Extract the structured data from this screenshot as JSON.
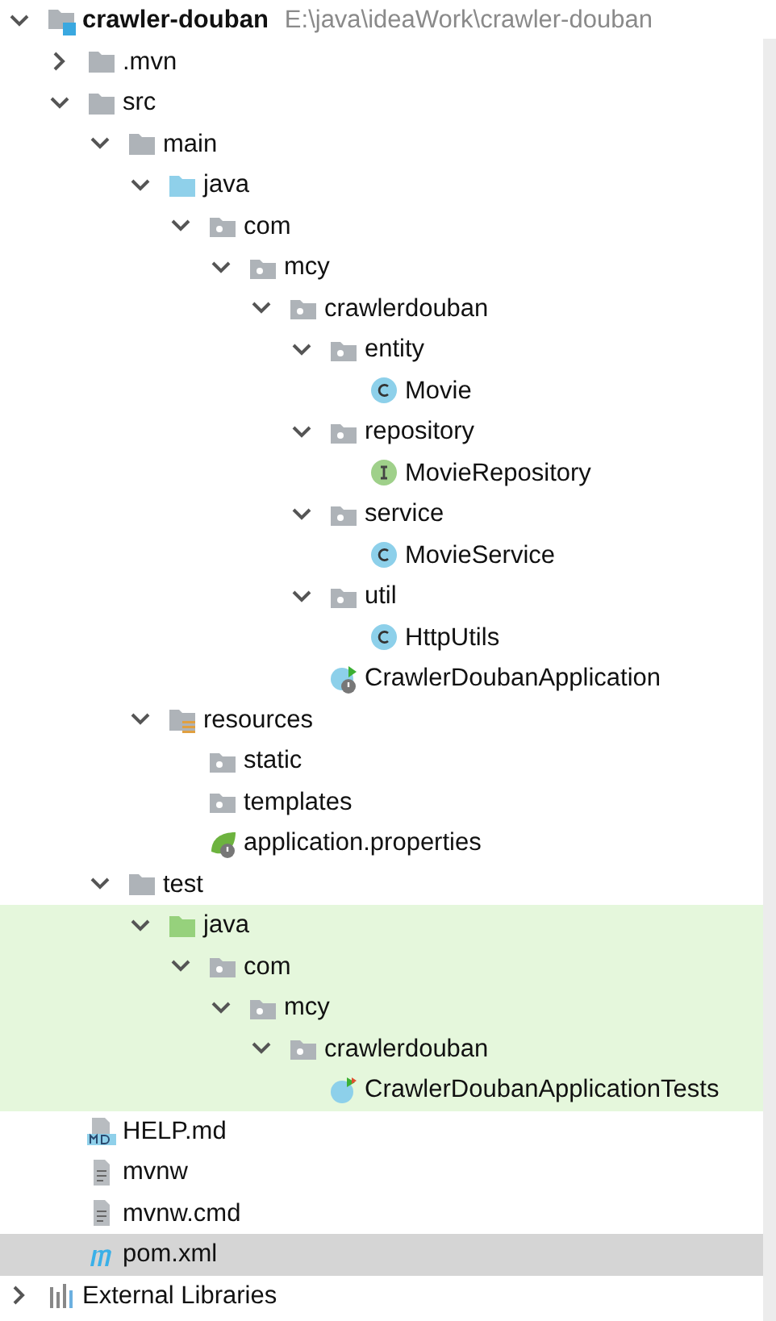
{
  "project_tree": {
    "root": {
      "name": "crawler-douban",
      "path": "E:\\java\\ideaWork\\crawler-douban",
      "kind": "module",
      "expanded": true,
      "selected": false,
      "children": [
        {
          "name": ".mvn",
          "kind": "folder",
          "expanded": false,
          "selected": false
        },
        {
          "name": "src",
          "kind": "folder",
          "expanded": true,
          "selected": false,
          "children": [
            {
              "name": "main",
              "kind": "folder",
              "expanded": true,
              "selected": false,
              "children": [
                {
                  "name": "java",
                  "kind": "source_folder",
                  "expanded": true,
                  "selected": false,
                  "children": [
                    {
                      "name": "com",
                      "kind": "package",
                      "expanded": true,
                      "selected": false,
                      "children": [
                        {
                          "name": "mcy",
                          "kind": "package",
                          "expanded": true,
                          "selected": false,
                          "children": [
                            {
                              "name": "crawlerdouban",
                              "kind": "package",
                              "expanded": true,
                              "selected": false,
                              "children": [
                                {
                                  "name": "entity",
                                  "kind": "package",
                                  "expanded": true,
                                  "selected": false,
                                  "children": [
                                    {
                                      "name": "Movie",
                                      "kind": "class",
                                      "selected": false
                                    }
                                  ]
                                },
                                {
                                  "name": "repository",
                                  "kind": "package",
                                  "expanded": true,
                                  "selected": false,
                                  "children": [
                                    {
                                      "name": "MovieRepository",
                                      "kind": "interface",
                                      "selected": false
                                    }
                                  ]
                                },
                                {
                                  "name": "service",
                                  "kind": "package",
                                  "expanded": true,
                                  "selected": false,
                                  "children": [
                                    {
                                      "name": "MovieService",
                                      "kind": "class",
                                      "selected": false
                                    }
                                  ]
                                },
                                {
                                  "name": "util",
                                  "kind": "package",
                                  "expanded": true,
                                  "selected": false,
                                  "children": [
                                    {
                                      "name": "HttpUtils",
                                      "kind": "class",
                                      "selected": false
                                    }
                                  ]
                                },
                                {
                                  "name": "CrawlerDoubanApplication",
                                  "kind": "spring_app",
                                  "selected": false
                                }
                              ]
                            }
                          ]
                        }
                      ]
                    }
                  ]
                },
                {
                  "name": "resources",
                  "kind": "resources_folder",
                  "expanded": true,
                  "selected": false,
                  "children": [
                    {
                      "name": "static",
                      "kind": "package",
                      "selected": false
                    },
                    {
                      "name": "templates",
                      "kind": "package",
                      "selected": false
                    },
                    {
                      "name": "application.properties",
                      "kind": "spring_props",
                      "selected": false
                    }
                  ]
                }
              ]
            },
            {
              "name": "test",
              "kind": "folder",
              "expanded": true,
              "selected": false,
              "children": [
                {
                  "name": "java",
                  "kind": "test_folder",
                  "test_scope": true,
                  "expanded": true,
                  "selected": false,
                  "children": [
                    {
                      "name": "com",
                      "kind": "package",
                      "expanded": true,
                      "selected": false,
                      "children": [
                        {
                          "name": "mcy",
                          "kind": "package",
                          "expanded": true,
                          "selected": false,
                          "children": [
                            {
                              "name": "crawlerdouban",
                              "kind": "package",
                              "expanded": true,
                              "selected": false,
                              "children": [
                                {
                                  "name": "CrawlerDoubanApplicationTests",
                                  "kind": "spring_test",
                                  "selected": false
                                }
                              ]
                            }
                          ]
                        }
                      ]
                    }
                  ]
                }
              ]
            }
          ]
        },
        {
          "name": "HELP.md",
          "kind": "markdown",
          "selected": false
        },
        {
          "name": "mvnw",
          "kind": "text_file",
          "selected": false
        },
        {
          "name": "mvnw.cmd",
          "kind": "text_file",
          "selected": false
        },
        {
          "name": "pom.xml",
          "kind": "maven",
          "selected": true
        }
      ]
    },
    "external": {
      "name": "External Libraries",
      "kind": "libraries",
      "expanded": false,
      "selected": false
    }
  }
}
